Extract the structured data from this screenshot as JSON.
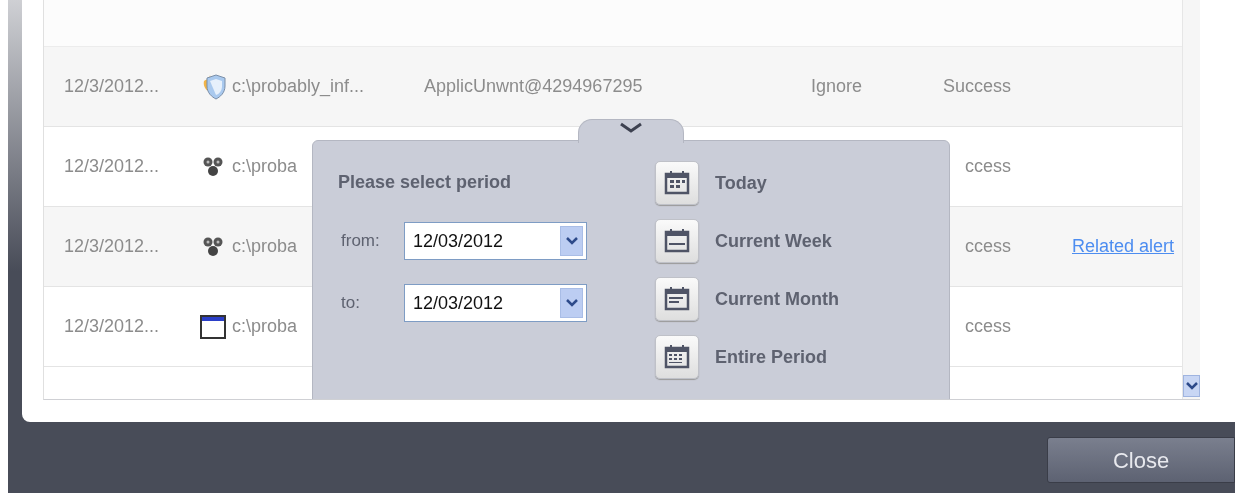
{
  "rows": [
    {
      "date": "12/3/2012...",
      "kind": "shield",
      "path": "c:\\probably_inf...",
      "rule": "ApplicUnwnt@4294967295",
      "action": "Ignore",
      "result": "Success"
    },
    {
      "date": "12/3/2012...",
      "kind": "cluster",
      "path": "c:\\proba",
      "result": "ccess"
    },
    {
      "date": "12/3/2012...",
      "kind": "cluster",
      "path": "c:\\proba",
      "result": "ccess",
      "link": "Related alert"
    },
    {
      "date": "12/3/2012...",
      "kind": "window",
      "path": "c:\\proba",
      "result": "ccess"
    }
  ],
  "period_popup": {
    "title": "Please select period",
    "fields": [
      {
        "label": "from:",
        "value": "12/03/2012"
      },
      {
        "label": "to:",
        "value": "12/03/2012"
      }
    ],
    "options": [
      {
        "label": "Today",
        "kind": "day"
      },
      {
        "label": "Current Week",
        "kind": "week"
      },
      {
        "label": "Current Month",
        "kind": "month"
      },
      {
        "label": "Entire Period",
        "kind": "all"
      }
    ]
  },
  "close_button": "Close"
}
